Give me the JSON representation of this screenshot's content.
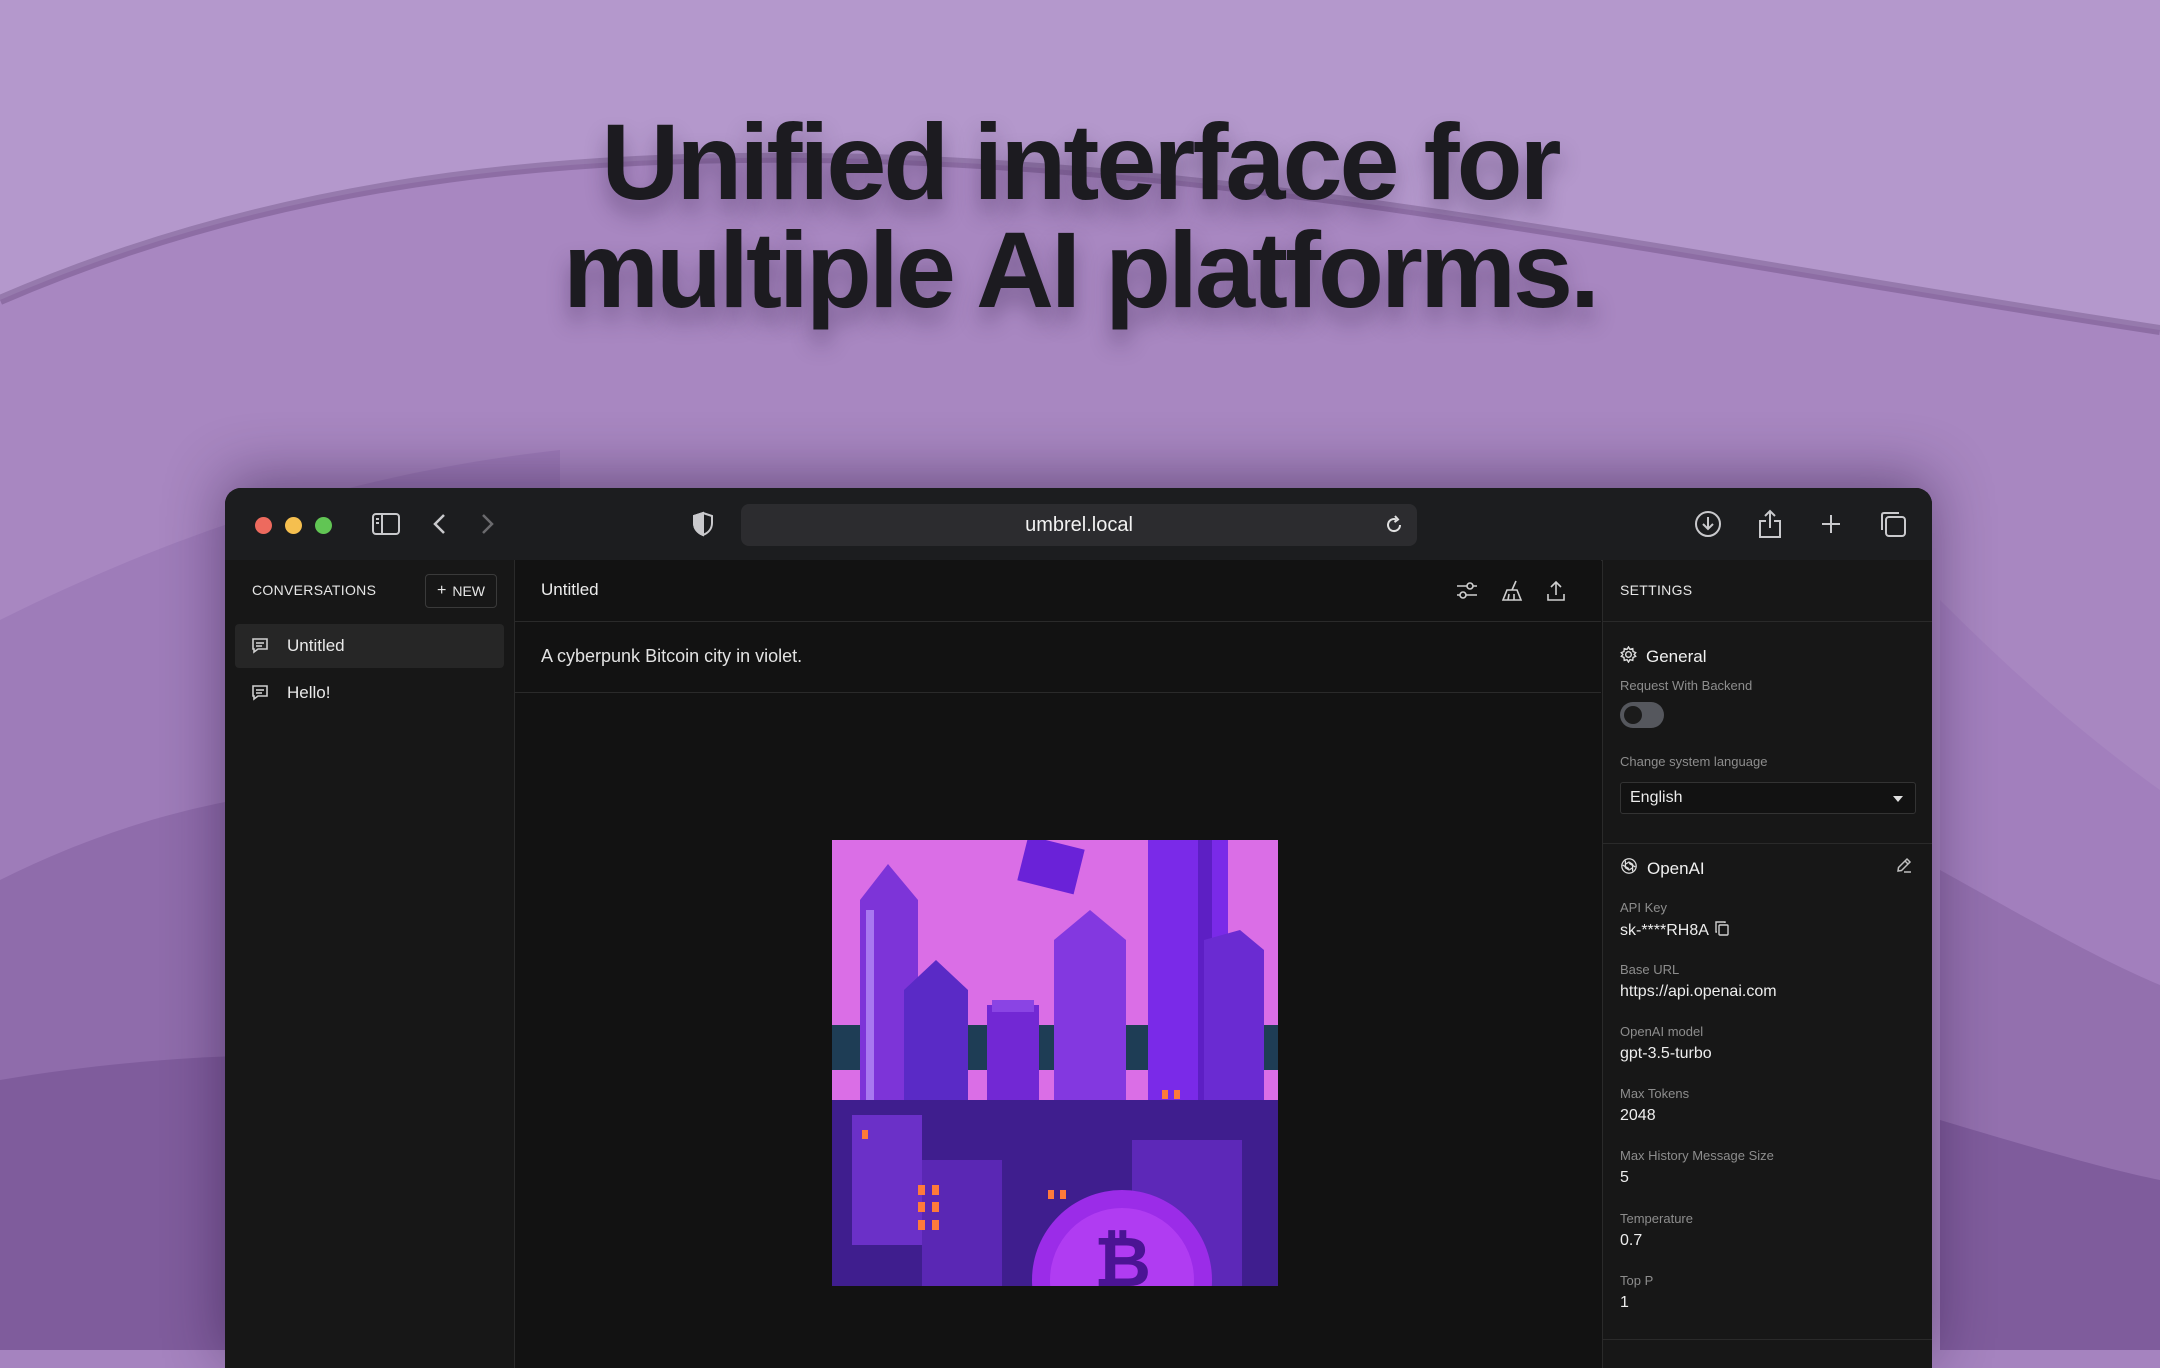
{
  "headline": {
    "line1": "Unified interface for",
    "line2": "multiple AI platforms."
  },
  "browser": {
    "address": "umbrel.local",
    "icons": [
      "sidebar-toggle-icon",
      "back-icon",
      "forward-icon",
      "shield-icon",
      "reload-icon",
      "download-icon",
      "share-icon",
      "plus-icon",
      "tabs-icon"
    ]
  },
  "sidebar": {
    "title": "CONVERSATIONS",
    "new_label": "NEW",
    "items": [
      {
        "label": "Untitled",
        "active": true
      },
      {
        "label": "Hello!",
        "active": false
      }
    ]
  },
  "main": {
    "title": "Untitled",
    "prompt": "A cyberpunk Bitcoin city in violet.",
    "header_icons": [
      "sliders-icon",
      "broom-icon",
      "export-icon"
    ]
  },
  "settings": {
    "title": "SETTINGS",
    "general": {
      "title": "General",
      "request_backend_label": "Request With Backend",
      "request_backend_on": false,
      "language_label": "Change system language",
      "language_value": "English"
    },
    "openai": {
      "title": "OpenAI",
      "api_key_label": "API Key",
      "api_key_value": "sk-****RH8A",
      "base_url_label": "Base URL",
      "base_url_value": "https://api.openai.com",
      "model_label": "OpenAI model",
      "model_value": "gpt-3.5-turbo",
      "max_tokens_label": "Max Tokens",
      "max_tokens_value": "2048",
      "max_history_label": "Max History Message Size",
      "max_history_value": "5",
      "temperature_label": "Temperature",
      "temperature_value": "0.7",
      "top_p_label": "Top P",
      "top_p_value": "1"
    }
  },
  "colors": {
    "background": "#a583bf",
    "window": "#121212",
    "titlebar": "#1c1d1f",
    "art_sky": "#d96be8",
    "art_tower": "#7a2fe0"
  }
}
